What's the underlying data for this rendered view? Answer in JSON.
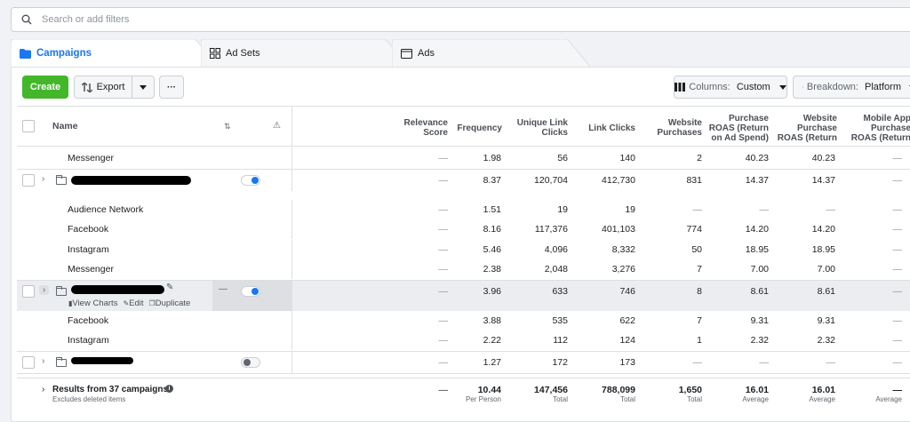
{
  "search": {
    "placeholder": "Search or add filters"
  },
  "tabs": {
    "campaigns": "Campaigns",
    "adsets": "Ad Sets",
    "ads": "Ads"
  },
  "toolbar": {
    "create": "Create",
    "export": "Export",
    "more": "···",
    "columns_prefix": "Columns: ",
    "columns_value": "Custom",
    "breakdown_prefix": "Breakdown: ",
    "breakdown_value": "Platform"
  },
  "columns": {
    "name": "Name",
    "relevance": "Relevance Score",
    "frequency": "Frequency",
    "unique_link_clicks": "Unique Link Clicks",
    "link_clicks": "Link Clicks",
    "website_purchases": "Website Purchases",
    "purchase_roas": "Purchase ROAS (Return on Ad Spend)",
    "website_purchase_roas": "Website Purchase ROAS (Return",
    "mobile_app_purchase": "Mobile App Purchase ROAS (Return"
  },
  "rows": [
    {
      "name": "Messenger",
      "rel": "—",
      "freq": "1.98",
      "ulc": "56",
      "lc": "140",
      "wp": "2",
      "roas": "40.23",
      "wroas": "40.23",
      "mroas": "—"
    },
    {
      "name": "",
      "rel": "—",
      "freq": "8.37",
      "ulc": "120,704",
      "lc": "412,730",
      "wp": "831",
      "roas": "14.37",
      "wroas": "14.37",
      "mroas": "—"
    },
    {
      "name": "Audience Network",
      "rel": "—",
      "freq": "1.51",
      "ulc": "19",
      "lc": "19",
      "wp": "—",
      "roas": "—",
      "wroas": "—",
      "mroas": "—"
    },
    {
      "name": "Facebook",
      "rel": "—",
      "freq": "8.16",
      "ulc": "117,376",
      "lc": "401,103",
      "wp": "774",
      "roas": "14.20",
      "wroas": "14.20",
      "mroas": "—"
    },
    {
      "name": "Instagram",
      "rel": "—",
      "freq": "5.46",
      "ulc": "4,096",
      "lc": "8,332",
      "wp": "50",
      "roas": "18.95",
      "wroas": "18.95",
      "mroas": "—"
    },
    {
      "name": "Messenger",
      "rel": "—",
      "freq": "2.38",
      "ulc": "2,048",
      "lc": "3,276",
      "wp": "7",
      "roas": "7.00",
      "wroas": "7.00",
      "mroas": "—"
    },
    {
      "name": "",
      "rel": "—",
      "freq": "3.96",
      "ulc": "633",
      "lc": "746",
      "wp": "8",
      "roas": "8.61",
      "wroas": "8.61",
      "mroas": "—"
    },
    {
      "name": "Facebook",
      "rel": "—",
      "freq": "3.88",
      "ulc": "535",
      "lc": "622",
      "wp": "7",
      "roas": "9.31",
      "wroas": "9.31",
      "mroas": "—"
    },
    {
      "name": "Instagram",
      "rel": "—",
      "freq": "2.22",
      "ulc": "112",
      "lc": "124",
      "wp": "1",
      "roas": "2.32",
      "wroas": "2.32",
      "mroas": "—"
    },
    {
      "name": "",
      "rel": "—",
      "freq": "1.27",
      "ulc": "172",
      "lc": "173",
      "wp": "—",
      "roas": "—",
      "wroas": "—",
      "mroas": "—"
    }
  ],
  "row_actions": {
    "view_charts": "View Charts",
    "edit": "Edit",
    "duplicate": "Duplicate",
    "dash": "—"
  },
  "totals": {
    "label": "Results from 37 campaigns",
    "sublabel": "Excludes deleted items",
    "rel": "—",
    "freq": "10.44",
    "freq_sub": "Per Person",
    "ulc": "147,456",
    "ulc_sub": "Total",
    "lc": "788,099",
    "lc_sub": "Total",
    "wp": "1,650",
    "wp_sub": "Total",
    "roas": "16.01",
    "roas_sub": "Average",
    "wroas": "16.01",
    "wroas_sub": "Average",
    "mroas": "—",
    "mroas_sub": "Average"
  },
  "toggles": [
    {
      "state": "on"
    },
    {
      "state": "on"
    },
    {
      "state": "off"
    }
  ],
  "colors": {
    "accent": "#1877f2",
    "create_green": "#42b72a",
    "toggle_on": "#1877f2",
    "toggle_off": "#bec3c9"
  },
  "icons": [
    "search-icon",
    "folder-icon",
    "grid-icon",
    "ad-icon",
    "export-icon",
    "caret-down-icon",
    "more-icon",
    "columns-icon",
    "breakdown-icon",
    "sort-icon",
    "warning-icon",
    "pencil-icon",
    "chart-icon",
    "duplicate-icon",
    "info-icon",
    "chevron-right-icon"
  ]
}
